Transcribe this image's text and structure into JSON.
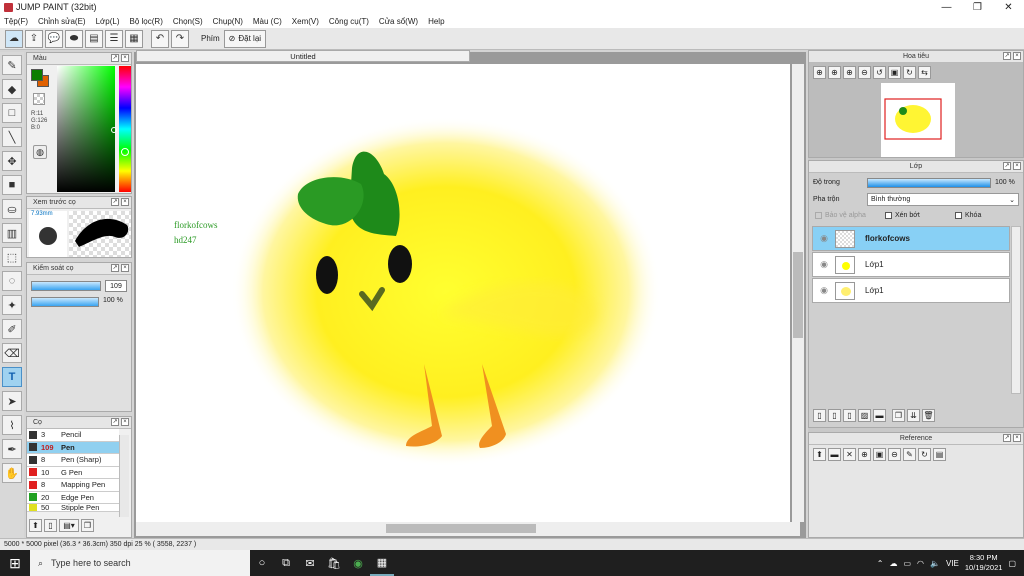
{
  "window": {
    "title": "JUMP PAINT (32bit)"
  },
  "menu": [
    "Tệp(F)",
    "Chỉnh sửa(E)",
    "Lớp(L)",
    "Bộ lọc(R)",
    "Chọn(S)",
    "Chụp(N)",
    "Màu (C)",
    "Xem(V)",
    "Công cụ(T)",
    "Cửa sổ(W)",
    "Help"
  ],
  "toolbar": {
    "phim_label": "Phím",
    "reset_label": "Đặt lại"
  },
  "color_panel": {
    "title": "Màu",
    "rgb": [
      "R:11",
      "G:126",
      "B:0"
    ],
    "fg_color": "#0b7e00",
    "bg_color": "#e06000"
  },
  "brush_preview": {
    "title": "Xem trước cọ",
    "size": "7.93mm"
  },
  "brush_control": {
    "title": "Kiểm soát cọ",
    "size_value": "109",
    "opacity_value": "100 %"
  },
  "brush_list": {
    "title": "Cọ",
    "items": [
      {
        "size": "3",
        "name": "Pencil",
        "color": "#333333",
        "selected": false
      },
      {
        "size": "109",
        "name": "Pen",
        "color": "#333333",
        "selected": true
      },
      {
        "size": "8",
        "name": "Pen (Sharp)",
        "color": "#333333",
        "selected": false
      },
      {
        "size": "10",
        "name": "G Pen",
        "color": "#e02020",
        "selected": false
      },
      {
        "size": "8",
        "name": "Mapping Pen",
        "color": "#e02020",
        "selected": false
      },
      {
        "size": "20",
        "name": "Edge Pen",
        "color": "#20a020",
        "selected": false
      },
      {
        "size": "50",
        "name": "Stipple Pen",
        "color": "#e0e020",
        "selected": false
      }
    ]
  },
  "canvas": {
    "tab": "Untitled",
    "text_lines": [
      "florkofcows",
      "hd247"
    ]
  },
  "navigator": {
    "title": "Hoa tiêu"
  },
  "layers": {
    "title": "Lớp",
    "opacity_label": "Độ trong",
    "opacity_value": "100 %",
    "blend_label": "Pha trộn",
    "blend_value": "Bình thường",
    "protect_alpha": "Bảo vệ alpha",
    "clipping": "Xén bớt",
    "lock": "Khóa",
    "items": [
      {
        "name": "florkofcows",
        "selected": true
      },
      {
        "name": "Lớp1",
        "selected": false
      },
      {
        "name": "Lớp1",
        "selected": false
      }
    ]
  },
  "reference": {
    "title": "Reference"
  },
  "status": {
    "text": "5000 * 5000 pixel  (36.3 * 36.3cm)  350 dpi  25 %  ( 3558, 2237 )"
  },
  "taskbar": {
    "search_placeholder": "Type here to search",
    "lang": "VIE",
    "time": "8:30 PM",
    "date": "10/19/2021"
  }
}
